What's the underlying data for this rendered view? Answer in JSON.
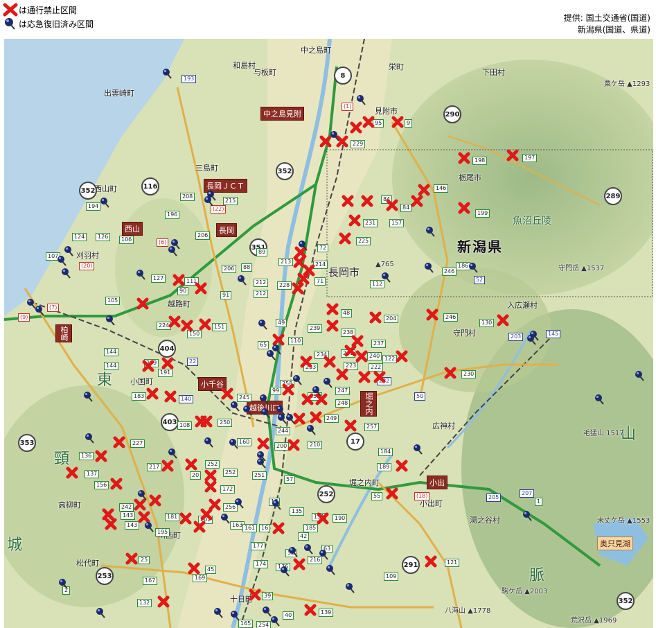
{
  "legend": {
    "closed": "は通行禁止区間",
    "restored": "は応急復旧済み区間"
  },
  "credit": {
    "line1": "提供: 国土交通省(国道)",
    "line2": "新潟県(国道、県道)"
  },
  "colors": {
    "closed_mark": "#e01818",
    "restored_mark": "#1c2a6e",
    "map_land": "#d9e1b6",
    "sea": "#b7d4e8",
    "river": "#8fbfe0",
    "expressway": "#2f9a3e"
  },
  "map": {
    "prefecture": "新潟県",
    "region_label": "魚沼丘陵",
    "box_labels": [
      {
        "id": "nakanoshima-ic",
        "text": "中之島見附"
      },
      {
        "id": "nagaoka-jct",
        "text": "長岡ＪＣＴ"
      },
      {
        "id": "nagaoka-ic",
        "text": "長岡"
      },
      {
        "id": "nishiyama-ic",
        "text": "西山"
      },
      {
        "id": "kashiwazaki-ic",
        "text": "柏崎"
      },
      {
        "id": "ojiya-ic",
        "text": "小千谷"
      },
      {
        "id": "echigo-kawaguchi-ic",
        "text": "越後川口"
      },
      {
        "id": "horinouchi-ic",
        "text": "堀之内"
      },
      {
        "id": "koide-ic",
        "text": "小出"
      },
      {
        "id": "okutadami-lake",
        "text": "奥只見湖"
      }
    ],
    "places": [
      {
        "id": "izumozaki",
        "text": "出雲崎町"
      },
      {
        "id": "washima",
        "text": "和島村"
      },
      {
        "id": "yoita",
        "text": "与板町"
      },
      {
        "id": "nakanoshima",
        "text": "中之島町"
      },
      {
        "id": "sakae",
        "text": "栄町"
      },
      {
        "id": "shitada",
        "text": "下田村"
      },
      {
        "id": "mitsuke",
        "text": "見附市"
      },
      {
        "id": "santo",
        "text": "三島町"
      },
      {
        "id": "tochio",
        "text": "栃尾市"
      },
      {
        "id": "nishiyama",
        "text": "西山町"
      },
      {
        "id": "kariwa",
        "text": "刈羽村"
      },
      {
        "id": "nagaoka-city",
        "text": "長岡市"
      },
      {
        "id": "koshiji",
        "text": "越路町"
      },
      {
        "id": "ojiya-city",
        "text": "小国町"
      },
      {
        "id": "iriirose",
        "text": "入広瀬村"
      },
      {
        "id": "morikado",
        "text": "守門村"
      },
      {
        "id": "hirokami",
        "text": "広神村"
      },
      {
        "id": "horinouchi",
        "text": "堀之内町"
      },
      {
        "id": "koide",
        "text": "小出町"
      },
      {
        "id": "yunotani",
        "text": "湯之谷村"
      },
      {
        "id": "takayanagi",
        "text": "高柳町"
      },
      {
        "id": "matsushiro",
        "text": "松代町"
      },
      {
        "id": "tokamachi",
        "text": "十日町"
      },
      {
        "id": "kawanishi",
        "text": "川西町"
      },
      {
        "id": "jo",
        "text": "城"
      },
      {
        "id": "kubiki",
        "text": "頸"
      },
      {
        "id": "higashi",
        "text": "東"
      },
      {
        "id": "sabaishi",
        "text": "山"
      },
      {
        "id": "myaku",
        "text": "脈"
      }
    ],
    "peaks": [
      {
        "id": "awagatake",
        "text": "粟ケ岳 ▲1293"
      },
      {
        "id": "moriyamon",
        "text": "守門岳 ▲1537"
      },
      {
        "id": "kegatake",
        "text": "毛猛山 1517"
      },
      {
        "id": "mitsudake",
        "text": "未丈ケ岳 ▲1553"
      },
      {
        "id": "komagatake",
        "text": "駒ケ岳 ▲2003"
      },
      {
        "id": "arasawadake",
        "text": "荒沢岳 ▲1969"
      },
      {
        "id": "hakkaisan",
        "text": "八海山 ▲1778"
      },
      {
        "id": "kanna",
        "text": "▲765"
      }
    ],
    "shields": [
      {
        "id": "s8",
        "text": "8"
      },
      {
        "id": "s290",
        "text": "290"
      },
      {
        "id": "s352a",
        "text": "352"
      },
      {
        "id": "s116",
        "text": "116"
      },
      {
        "id": "s351",
        "text": "351"
      },
      {
        "id": "s404",
        "text": "404"
      },
      {
        "id": "s252",
        "text": "252"
      },
      {
        "id": "s17",
        "text": "17"
      },
      {
        "id": "s291",
        "text": "291"
      },
      {
        "id": "s403",
        "text": "403"
      },
      {
        "id": "s253",
        "text": "253"
      },
      {
        "id": "s289",
        "text": "289"
      },
      {
        "id": "s352b",
        "text": "352"
      },
      {
        "id": "s352c",
        "text": "352"
      },
      {
        "id": "s353",
        "text": "353"
      }
    ],
    "routes": [
      {
        "id": "r193",
        "text": "193",
        "kind": "n"
      },
      {
        "id": "r1",
        "text": "(1)",
        "kind": "p"
      },
      {
        "id": "r95",
        "text": "95",
        "kind": "g"
      },
      {
        "id": "r9",
        "text": "9",
        "kind": "g"
      },
      {
        "id": "r229",
        "text": "229",
        "kind": "g"
      },
      {
        "id": "r198",
        "text": "198",
        "kind": "g"
      },
      {
        "id": "r197",
        "text": "197",
        "kind": "g"
      },
      {
        "id": "r146",
        "text": "146",
        "kind": "g"
      },
      {
        "id": "r208",
        "text": "208",
        "kind": "g"
      },
      {
        "id": "r215",
        "text": "215",
        "kind": "g"
      },
      {
        "id": "r22p",
        "text": "(22)",
        "kind": "p"
      },
      {
        "id": "r194",
        "text": "194",
        "kind": "g"
      },
      {
        "id": "r196",
        "text": "196",
        "kind": "g"
      },
      {
        "id": "r206a",
        "text": "206",
        "kind": "g"
      },
      {
        "id": "r84a",
        "text": "84",
        "kind": "g"
      },
      {
        "id": "r84b",
        "text": "84",
        "kind": "g"
      },
      {
        "id": "r231",
        "text": "231",
        "kind": "g"
      },
      {
        "id": "r157",
        "text": "157",
        "kind": "g"
      },
      {
        "id": "r199",
        "text": "199",
        "kind": "g"
      },
      {
        "id": "r124",
        "text": "124",
        "kind": "g"
      },
      {
        "id": "r126",
        "text": "126",
        "kind": "g"
      },
      {
        "id": "r106",
        "text": "106",
        "kind": "g"
      },
      {
        "id": "r6p",
        "text": "(6)",
        "kind": "p"
      },
      {
        "id": "r225",
        "text": "225",
        "kind": "g"
      },
      {
        "id": "r72",
        "text": "72",
        "kind": "g"
      },
      {
        "id": "r107",
        "text": "107",
        "kind": "g"
      },
      {
        "id": "r20p",
        "text": "(20)",
        "kind": "p"
      },
      {
        "id": "r206b",
        "text": "206",
        "kind": "g"
      },
      {
        "id": "r88",
        "text": "88",
        "kind": "g"
      },
      {
        "id": "r89",
        "text": "89",
        "kind": "g"
      },
      {
        "id": "r213",
        "text": "213",
        "kind": "g"
      },
      {
        "id": "r214",
        "text": "214",
        "kind": "g"
      },
      {
        "id": "r246a",
        "text": "246",
        "kind": "g"
      },
      {
        "id": "r186",
        "text": "186",
        "kind": "g"
      },
      {
        "id": "r52",
        "text": "52",
        "kind": "n"
      },
      {
        "id": "r112",
        "text": "112",
        "kind": "g"
      },
      {
        "id": "r127",
        "text": "127",
        "kind": "g"
      },
      {
        "id": "r111",
        "text": "111",
        "kind": "g"
      },
      {
        "id": "r212a",
        "text": "212",
        "kind": "g"
      },
      {
        "id": "r212b",
        "text": "212",
        "kind": "g"
      },
      {
        "id": "r228",
        "text": "228",
        "kind": "g"
      },
      {
        "id": "r71",
        "text": "71",
        "kind": "g"
      },
      {
        "id": "r9p",
        "text": "(9)",
        "kind": "p"
      },
      {
        "id": "r7p",
        "text": "(7)",
        "kind": "p"
      },
      {
        "id": "r105",
        "text": "105",
        "kind": "g"
      },
      {
        "id": "r90",
        "text": "90",
        "kind": "g"
      },
      {
        "id": "r91",
        "text": "91",
        "kind": "g"
      },
      {
        "id": "r48",
        "text": "48",
        "kind": "g"
      },
      {
        "id": "r204",
        "text": "204",
        "kind": "g"
      },
      {
        "id": "r246b",
        "text": "246",
        "kind": "g"
      },
      {
        "id": "r130",
        "text": "130",
        "kind": "g"
      },
      {
        "id": "r145",
        "text": "145",
        "kind": "n"
      },
      {
        "id": "r203",
        "text": "203",
        "kind": "n"
      },
      {
        "id": "r224",
        "text": "224",
        "kind": "g"
      },
      {
        "id": "r150",
        "text": "150",
        "kind": "g"
      },
      {
        "id": "r151",
        "text": "151",
        "kind": "g"
      },
      {
        "id": "r49",
        "text": "49",
        "kind": "g"
      },
      {
        "id": "r239",
        "text": "239",
        "kind": "g"
      },
      {
        "id": "r238",
        "text": "238",
        "kind": "g"
      },
      {
        "id": "r65",
        "text": "65",
        "kind": "g"
      },
      {
        "id": "r110",
        "text": "110",
        "kind": "g"
      },
      {
        "id": "r237",
        "text": "237",
        "kind": "g"
      },
      {
        "id": "r144a",
        "text": "144",
        "kind": "g"
      },
      {
        "id": "r144b",
        "text": "144",
        "kind": "g"
      },
      {
        "id": "r209",
        "text": "209",
        "kind": "g"
      },
      {
        "id": "r191",
        "text": "191",
        "kind": "g"
      },
      {
        "id": "r22",
        "text": "22",
        "kind": "n"
      },
      {
        "id": "r234",
        "text": "234",
        "kind": "g"
      },
      {
        "id": "r241",
        "text": "241",
        "kind": "g"
      },
      {
        "id": "r240",
        "text": "240",
        "kind": "g"
      },
      {
        "id": "r122",
        "text": "122",
        "kind": "g"
      },
      {
        "id": "r253",
        "text": "253",
        "kind": "g"
      },
      {
        "id": "r223",
        "text": "223",
        "kind": "g"
      },
      {
        "id": "r222",
        "text": "222",
        "kind": "g"
      },
      {
        "id": "r232",
        "text": "232",
        "kind": "n"
      },
      {
        "id": "r230",
        "text": "230",
        "kind": "g"
      },
      {
        "id": "r258",
        "text": "258",
        "kind": "g"
      },
      {
        "id": "r183",
        "text": "183",
        "kind": "g"
      },
      {
        "id": "r140",
        "text": "140",
        "kind": "n"
      },
      {
        "id": "r245",
        "text": "245",
        "kind": "g"
      },
      {
        "id": "r99",
        "text": "99",
        "kind": "g"
      },
      {
        "id": "r255",
        "text": "255",
        "kind": "g"
      },
      {
        "id": "r247",
        "text": "247",
        "kind": "g"
      },
      {
        "id": "r248",
        "text": "248",
        "kind": "g"
      },
      {
        "id": "r50",
        "text": "50",
        "kind": "n"
      },
      {
        "id": "r108",
        "text": "108",
        "kind": "g"
      },
      {
        "id": "r250",
        "text": "250",
        "kind": "g"
      },
      {
        "id": "r249",
        "text": "249",
        "kind": "g"
      },
      {
        "id": "r257",
        "text": "257",
        "kind": "g"
      },
      {
        "id": "r244",
        "text": "244",
        "kind": "g"
      },
      {
        "id": "r227",
        "text": "227",
        "kind": "g"
      },
      {
        "id": "r160",
        "text": "160",
        "kind": "g"
      },
      {
        "id": "r200",
        "text": "200",
        "kind": "g"
      },
      {
        "id": "r210",
        "text": "210",
        "kind": "g"
      },
      {
        "id": "r184",
        "text": "184",
        "kind": "g"
      },
      {
        "id": "r136",
        "text": "136",
        "kind": "g"
      },
      {
        "id": "r137",
        "text": "137",
        "kind": "g"
      },
      {
        "id": "r217",
        "text": "217",
        "kind": "g"
      },
      {
        "id": "r252r",
        "text": "252",
        "kind": "g"
      },
      {
        "id": "r20",
        "text": "20",
        "kind": "g"
      },
      {
        "id": "r252s",
        "text": "252",
        "kind": "g"
      },
      {
        "id": "r251",
        "text": "251",
        "kind": "g"
      },
      {
        "id": "r189",
        "text": "189",
        "kind": "g"
      },
      {
        "id": "r18p",
        "text": "(18)",
        "kind": "p"
      },
      {
        "id": "r156",
        "text": "156",
        "kind": "g"
      },
      {
        "id": "r172",
        "text": "172",
        "kind": "g"
      },
      {
        "id": "r57",
        "text": "57",
        "kind": "g"
      },
      {
        "id": "r55",
        "text": "55",
        "kind": "g"
      },
      {
        "id": "r205",
        "text": "205",
        "kind": "n"
      },
      {
        "id": "r207",
        "text": "207",
        "kind": "n"
      },
      {
        "id": "r1g",
        "text": "1",
        "kind": "g"
      },
      {
        "id": "r242",
        "text": "242",
        "kind": "g"
      },
      {
        "id": "r143a",
        "text": "143",
        "kind": "g"
      },
      {
        "id": "r143b",
        "text": "143",
        "kind": "g"
      },
      {
        "id": "r181",
        "text": "181",
        "kind": "g"
      },
      {
        "id": "r201",
        "text": "201",
        "kind": "g"
      },
      {
        "id": "r256",
        "text": "256",
        "kind": "g"
      },
      {
        "id": "r17",
        "text": "17",
        "kind": "g"
      },
      {
        "id": "r135",
        "text": "135",
        "kind": "g"
      },
      {
        "id": "r131",
        "text": "131",
        "kind": "g"
      },
      {
        "id": "r190",
        "text": "190",
        "kind": "g"
      },
      {
        "id": "r195",
        "text": "195",
        "kind": "g"
      },
      {
        "id": "r163",
        "text": "163",
        "kind": "g"
      },
      {
        "id": "r161",
        "text": "161",
        "kind": "g"
      },
      {
        "id": "r16",
        "text": "16",
        "kind": "g"
      },
      {
        "id": "r185",
        "text": "185",
        "kind": "g"
      },
      {
        "id": "r42",
        "text": "42",
        "kind": "g"
      },
      {
        "id": "r177",
        "text": "177",
        "kind": "g"
      },
      {
        "id": "r52b",
        "text": "52",
        "kind": "g"
      },
      {
        "id": "r63",
        "text": "63",
        "kind": "g"
      },
      {
        "id": "r25",
        "text": "25",
        "kind": "g"
      },
      {
        "id": "r174",
        "text": "174",
        "kind": "g"
      },
      {
        "id": "r176",
        "text": "176",
        "kind": "g"
      },
      {
        "id": "r216",
        "text": "216",
        "kind": "g"
      },
      {
        "id": "r121",
        "text": "121",
        "kind": "g"
      },
      {
        "id": "r45",
        "text": "45",
        "kind": "g"
      },
      {
        "id": "r167",
        "text": "167",
        "kind": "g"
      },
      {
        "id": "r169",
        "text": "169",
        "kind": "g"
      },
      {
        "id": "r109",
        "text": "109",
        "kind": "g"
      },
      {
        "id": "r2",
        "text": "2",
        "kind": "g"
      },
      {
        "id": "r39",
        "text": "39",
        "kind": "g"
      },
      {
        "id": "r132",
        "text": "132",
        "kind": "g"
      },
      {
        "id": "r139",
        "text": "139",
        "kind": "g"
      },
      {
        "id": "r40",
        "text": "40",
        "kind": "g"
      },
      {
        "id": "r254",
        "text": "254",
        "kind": "g"
      },
      {
        "id": "r165",
        "text": "165",
        "kind": "g"
      }
    ]
  }
}
